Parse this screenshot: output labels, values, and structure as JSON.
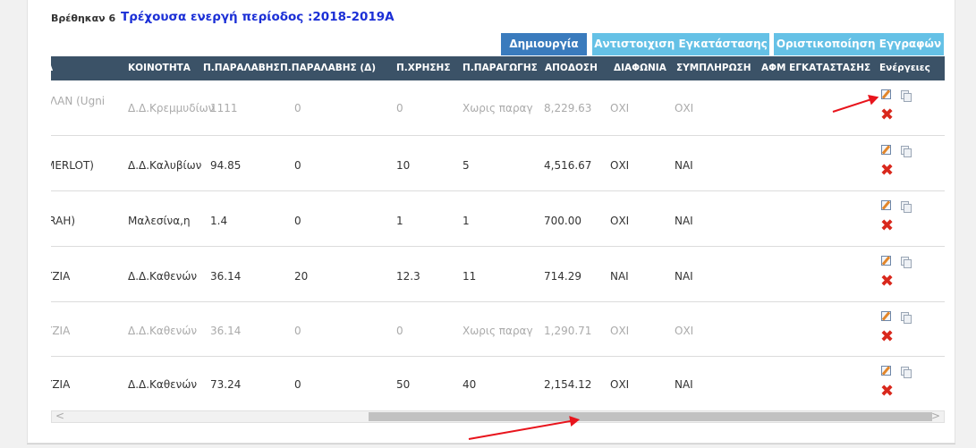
{
  "summary": {
    "found_text": "Βρέθηκαν 6",
    "period_text": "Τρέχουσα ενεργή περίοδος :2018-2019Α"
  },
  "toolbar": {
    "create_label": "Δημιουργία",
    "match_label": "Αντιστοιχιση Εγκατάστασης",
    "finalize_label": "Οριστικοποίηση Εγγραφών"
  },
  "table": {
    "headers": [
      "Α",
      "ΚΟΙΝΟΤΗΤΑ",
      "Π.ΠΑΡΑΛΑΒΗΣ",
      "Π.ΠΑΡΑΛΑΒΗΣ (Δ)",
      "Π.ΧΡΗΣΗΣ",
      "Π.ΠΑΡΑΓΩΓΗΣ",
      "ΑΠΟΔΟΣΗ",
      "ΔΙΑΦΩΝΙΑ",
      "ΣΥΜΠΛΗΡΩΣΗ",
      "ΑΦΜ ΕΓΚΑΤΑΣΤΑΣΗΣ",
      "Ενέργειες"
    ],
    "rows": [
      {
        "faded": true,
        "cells": [
          "ΊΛΑΝ  (Ugni",
          "Δ.Δ.Κρεμμυδίων",
          "1111",
          "0",
          "0",
          "Χωρις παραγ",
          "8,229.63",
          "ΟΧΙ",
          "ΟΧΙ",
          ""
        ]
      },
      {
        "faded": false,
        "cells": [
          "MERLOT)",
          "Δ.Δ.Καλυβίων",
          "94.85",
          "0",
          "10",
          "5",
          "4,516.67",
          "ΟΧΙ",
          "ΝΑΙ",
          ""
        ]
      },
      {
        "faded": false,
        "cells": [
          "'RAH)",
          "Μαλεσίνα,η",
          "1.4",
          "0",
          "1",
          "1",
          "700.00",
          "ΟΧΙ",
          "ΝΑΙ",
          ""
        ]
      },
      {
        "faded": false,
        "cells": [
          "ΥΖΙΑ",
          "Δ.Δ.Καθενών",
          "36.14",
          "20",
          "12.3",
          "11",
          "714.29",
          "ΝΑΙ",
          "ΝΑΙ",
          ""
        ]
      },
      {
        "faded": true,
        "cells": [
          "ΥΖΙΑ",
          "Δ.Δ.Καθενών",
          "36.14",
          "0",
          "0",
          "Χωρις παραγ",
          "1,290.71",
          "ΟΧΙ",
          "ΟΧΙ",
          ""
        ]
      },
      {
        "faded": false,
        "cells": [
          "ΥΖΙΑ",
          "Δ.Δ.Καθενών",
          "73.24",
          "0",
          "50",
          "40",
          "2,154.12",
          "ΟΧΙ",
          "ΝΑΙ",
          ""
        ]
      }
    ]
  },
  "scrollbar": {
    "left_arrow": "<",
    "right_arrow": ">"
  },
  "icons": {
    "edit": "edit-icon",
    "copy": "copy-icon",
    "delete": "delete-icon"
  },
  "colors": {
    "header_bg": "#3b5267",
    "create_btn": "#3a7bbd",
    "secondary_btn": "#65c1e6",
    "period_text": "#1b2fd6",
    "delete": "#d9281c",
    "annotation_arrow": "#e8141c"
  }
}
